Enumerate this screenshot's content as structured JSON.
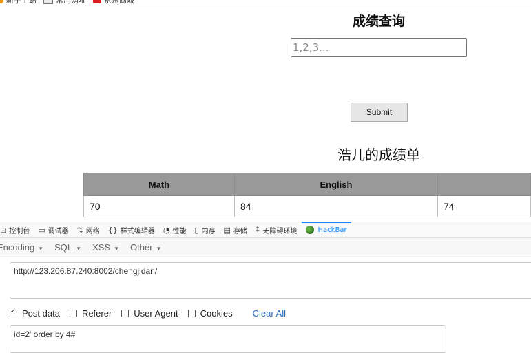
{
  "bookmarks": [
    {
      "label": "新手上路",
      "icon": "fire-icon"
    },
    {
      "label": "常用网址",
      "icon": "folder-icon"
    },
    {
      "label": "京东商城",
      "icon": "jd-icon"
    }
  ],
  "page": {
    "title": "成绩查询",
    "input_placeholder": "1,2,3...",
    "submit_label": "Submit",
    "report_title": "浩儿的成绩单",
    "table": {
      "headers": [
        "Math",
        "English",
        ""
      ],
      "rows": [
        [
          "70",
          "84",
          "74"
        ]
      ]
    }
  },
  "devtools": {
    "tabs": [
      {
        "label": "控制台",
        "icon": "console-icon"
      },
      {
        "label": "调试器",
        "icon": "debugger-icon"
      },
      {
        "label": "网络",
        "icon": "network-icon"
      },
      {
        "label": "样式编辑器",
        "icon": "style-editor-icon"
      },
      {
        "label": "性能",
        "icon": "performance-icon"
      },
      {
        "label": "内存",
        "icon": "memory-icon"
      },
      {
        "label": "存储",
        "icon": "storage-icon"
      },
      {
        "label": "无障碍环境",
        "icon": "accessibility-icon"
      },
      {
        "label": "HackBar",
        "icon": "hackbar-icon",
        "active": true
      }
    ],
    "accent_color": "#0a84ff"
  },
  "hackbar": {
    "menus": [
      "Encoding",
      "SQL",
      "XSS",
      "Other"
    ],
    "url": "http://123.206.87.240:8002/chengjidan/",
    "options": [
      {
        "label": "Post data",
        "checked": true
      },
      {
        "label": "Referer",
        "checked": false
      },
      {
        "label": "User Agent",
        "checked": false
      },
      {
        "label": "Cookies",
        "checked": false
      }
    ],
    "clear_all": "Clear All",
    "post_data": "id=2' order by 4#"
  }
}
